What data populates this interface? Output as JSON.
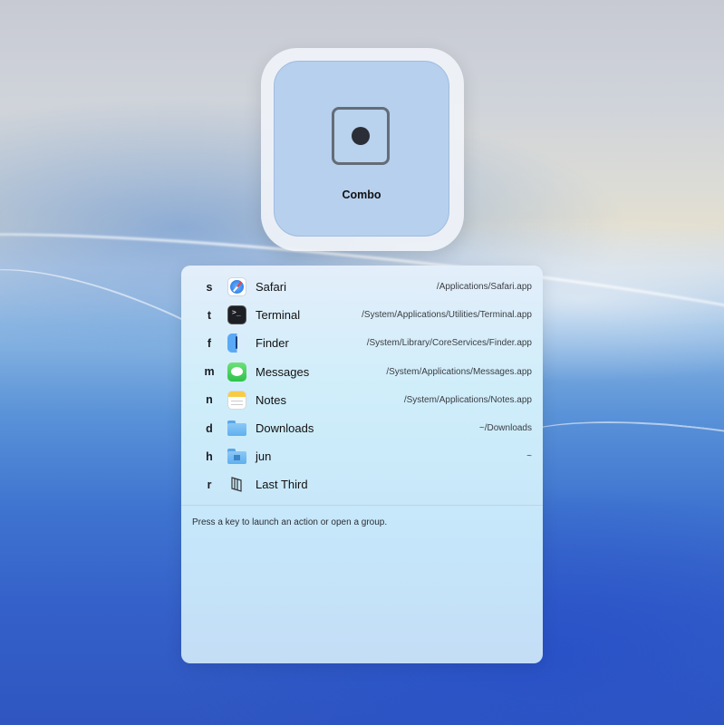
{
  "hud": {
    "mode_label": "Combo"
  },
  "items": [
    {
      "key": "s",
      "name": "Safari",
      "path": "/Applications/Safari.app",
      "icon": "safari-icon"
    },
    {
      "key": "t",
      "name": "Terminal",
      "path": "/System/Applications/Utilities/Terminal.app",
      "icon": "terminal-icon"
    },
    {
      "key": "f",
      "name": "Finder",
      "path": "/System/Library/CoreServices/Finder.app",
      "icon": "finder-icon"
    },
    {
      "key": "m",
      "name": "Messages",
      "path": "/System/Applications/Messages.app",
      "icon": "messages-icon"
    },
    {
      "key": "n",
      "name": "Notes",
      "path": "/System/Applications/Notes.app",
      "icon": "notes-icon"
    },
    {
      "key": "d",
      "name": "Downloads",
      "path": "~/Downloads",
      "icon": "folder-icon"
    },
    {
      "key": "h",
      "name": "jun",
      "path": "~",
      "icon": "home-folder-icon"
    },
    {
      "key": "r",
      "name": "Last Third",
      "path": "",
      "icon": "window-layout-icon"
    }
  ],
  "footer": {
    "hint": "Press a key to launch an action or open a group."
  },
  "colors": {
    "hud_fill": "#b6d0ee",
    "panel_top": "#e3eefa",
    "panel_bottom": "#c4ddf6"
  }
}
